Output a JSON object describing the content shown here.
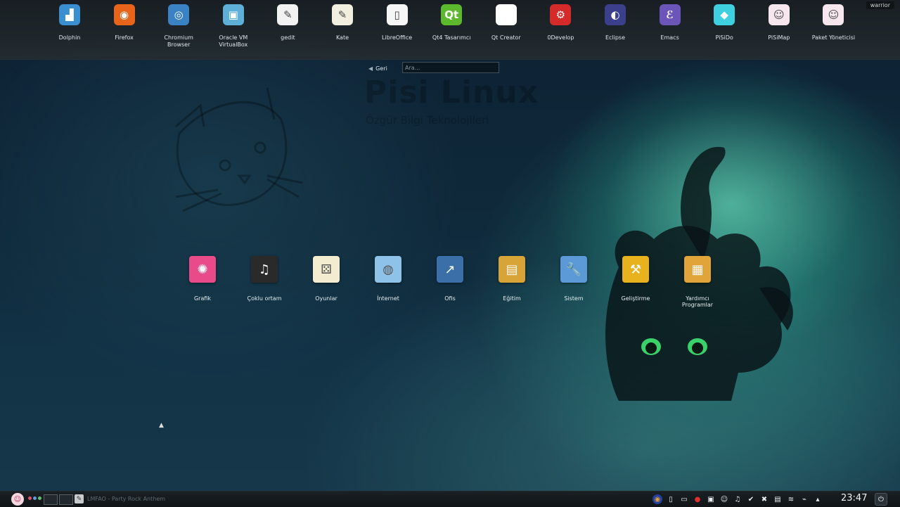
{
  "favorites": [
    {
      "label": "Dolphin",
      "icon": "dolphin-icon",
      "color": "#3a8fd0",
      "glyph": "▟"
    },
    {
      "label": "Firefox",
      "icon": "firefox-icon",
      "color": "#e8641b",
      "glyph": "◉"
    },
    {
      "label": "Chromium Browser",
      "icon": "chromium-icon",
      "color": "#3b82c4",
      "glyph": "◎"
    },
    {
      "label": "Oracle VM VirtualBox",
      "icon": "virtualbox-icon",
      "color": "#5fb0d8",
      "glyph": "▣"
    },
    {
      "label": "gedit",
      "icon": "gedit-icon",
      "color": "#f2f2f2",
      "glyph": "✎"
    },
    {
      "label": "Kate",
      "icon": "kate-icon",
      "color": "#f3efe0",
      "glyph": "✎"
    },
    {
      "label": "LibreOffice",
      "icon": "libreoffice-icon",
      "color": "#f6f6f6",
      "glyph": "▯"
    },
    {
      "label": "Qt4 Tasarımcı",
      "icon": "qt-designer-icon",
      "color": "#5cb82d",
      "glyph": "Qt"
    },
    {
      "label": "Qt Creator",
      "icon": "qt-creator-icon",
      "color": "#ffffff",
      "glyph": ""
    },
    {
      "label": "0Develop",
      "icon": "kdevelop-icon",
      "color": "#d42a2a",
      "glyph": "⚙"
    },
    {
      "label": "Eclipse",
      "icon": "eclipse-icon",
      "color": "#3b3f8c",
      "glyph": "◐"
    },
    {
      "label": "Emacs",
      "icon": "emacs-icon",
      "color": "#6b55b8",
      "glyph": "ℰ"
    },
    {
      "label": "PiSiDo",
      "icon": "pisido-icon",
      "color": "#3fd0e0",
      "glyph": "◆"
    },
    {
      "label": "PiSiMap",
      "icon": "pisimap-icon",
      "color": "#f6e7ee",
      "glyph": "☺"
    },
    {
      "label": "Paket Yöneticisi",
      "icon": "package-manager-icon",
      "color": "#f6e7ee",
      "glyph": "☺"
    }
  ],
  "user_badge": "warrior",
  "back_label": "Geri",
  "search_placeholder": "Ara...",
  "watermark": {
    "title": "Pisi Linux",
    "subtitle": "Özgür Bilgi Teknolojileri"
  },
  "categories": [
    {
      "label": "Grafik",
      "icon": "graphics-icon",
      "color": "#e84a8a",
      "glyph": "✺"
    },
    {
      "label": "Çoklu ortam",
      "icon": "multimedia-icon",
      "color": "#2a2a2a",
      "glyph": "♫"
    },
    {
      "label": "Oyunlar",
      "icon": "games-icon",
      "color": "#f3ecd0",
      "glyph": "⚄"
    },
    {
      "label": "İnternet",
      "icon": "internet-icon",
      "color": "#8fc2e8",
      "glyph": "◍"
    },
    {
      "label": "Ofis",
      "icon": "office-icon",
      "color": "#3a6fa8",
      "glyph": "↗"
    },
    {
      "label": "Eğitim",
      "icon": "education-icon",
      "color": "#d9a437",
      "glyph": "▤"
    },
    {
      "label": "Sistem",
      "icon": "system-icon",
      "color": "#5b9ad6",
      "glyph": "🔧"
    },
    {
      "label": "Geliştirme",
      "icon": "development-icon",
      "color": "#e8b21e",
      "glyph": "⚒"
    },
    {
      "label": "Yardımcı Programlar",
      "icon": "utilities-icon",
      "color": "#e0a43a",
      "glyph": "▦"
    }
  ],
  "taskbar": {
    "task_title": "LMFAO - Party Rock Anthem",
    "clock": "23:47",
    "pager_colors": [
      "#e0506a",
      "#5aa0e0",
      "#60c070"
    ],
    "tray_icons": [
      "network-icon",
      "clipboard-icon",
      "window-icon",
      "record-icon",
      "media-icon",
      "cat-icon",
      "music-icon",
      "check-icon",
      "tools-icon",
      "display-icon",
      "wifi-icon",
      "usb-icon",
      "arrow-up-icon"
    ]
  }
}
